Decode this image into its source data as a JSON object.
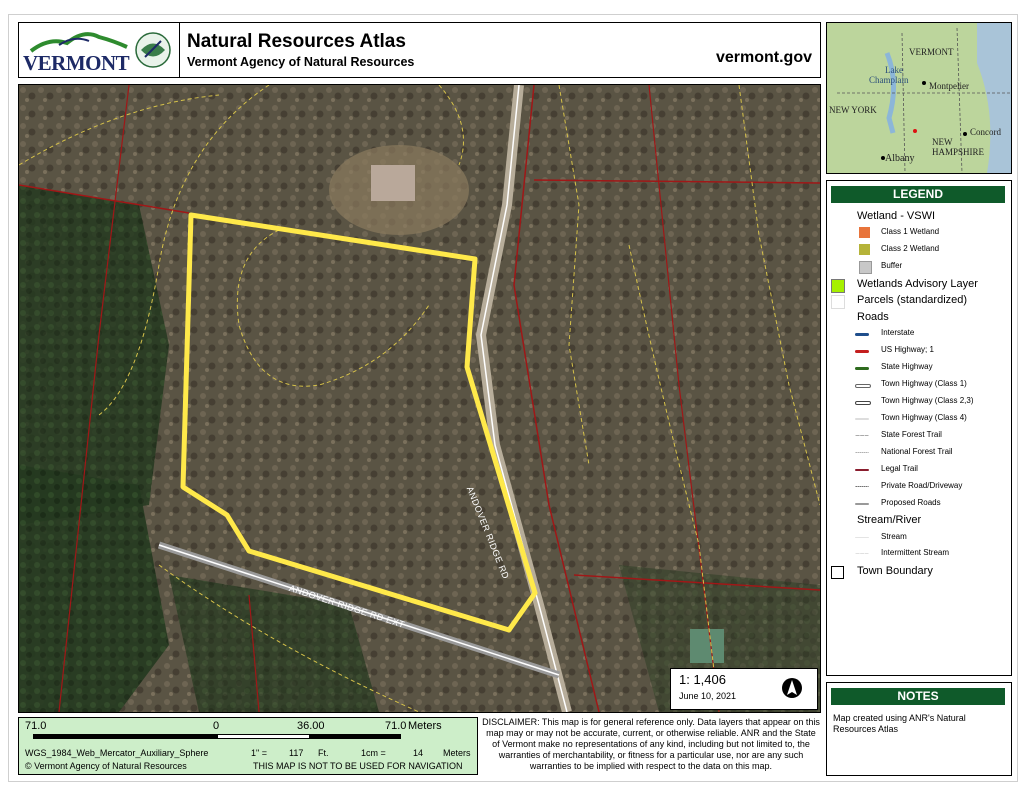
{
  "header": {
    "vermont_logo_text": "VERMONT",
    "title": "Natural Resources Atlas",
    "subtitle": "Vermont Agency of Natural Resources",
    "site": "vermont.gov"
  },
  "inset": {
    "labels": [
      "VERMONT",
      "Lake",
      "Champlain",
      "Montpelier",
      "NEW YORK",
      "Concord",
      "NEW",
      "HAMPSHIRE",
      "Albany"
    ]
  },
  "map": {
    "road_labels": [
      "ANDOVER RIDGE RD",
      "ANDOVER RIDGE RD EXT"
    ],
    "scale": "1: 1,406",
    "date": "June 10, 2021"
  },
  "legend": {
    "title": "LEGEND",
    "wetland_title": "Wetland - VSWI",
    "class1": "Class 1 Wetland",
    "class2": "Class 2 Wetland",
    "buffer": "Buffer",
    "advisory": "Wetlands Advisory Layer",
    "parcels": "Parcels (standardized)",
    "roads_title": "Roads",
    "interstate": "Interstate",
    "us_highway": "US Highway; 1",
    "state_highway": "State Highway",
    "town1": "Town Highway (Class 1)",
    "town23": "Town Highway (Class 2,3)",
    "town4": "Town Highway (Class 4)",
    "state_forest": "State Forest Trail",
    "national_forest": "National Forest Trail",
    "legal_trail": "Legal Trail",
    "private_road": "Private Road/Driveway",
    "proposed": "Proposed Roads",
    "stream_title": "Stream/River",
    "stream": "Stream",
    "intermittent": "Intermittent Stream",
    "town_boundary": "Town Boundary",
    "colors": {
      "class1": "#e8743b",
      "class2": "#b5b339",
      "buffer": "#c8c8c8",
      "advisory": "#a6f000",
      "interstate": "#1f4e8c",
      "us_highway": "#c41e1e",
      "state_highway": "#2e6b1e"
    }
  },
  "notes": {
    "title": "NOTES",
    "text": "Map created using ANR's Natural Resources Atlas"
  },
  "scalebar": {
    "left": "71.0",
    "zero": "0",
    "mid": "36.00",
    "right": "71.0",
    "unit": "Meters",
    "projection": "WGS_1984_Web_Mercator_Auxiliary_Sphere",
    "inch_label": "1\" =",
    "inch_value": "117",
    "inch_unit": "Ft.",
    "cm_label": "1cm =",
    "cm_value": "14",
    "cm_unit": "Meters",
    "copyright": "© Vermont Agency of Natural Resources",
    "nav_warning": "THIS MAP IS NOT TO BE USED FOR NAVIGATION"
  },
  "disclaimer": "DISCLAIMER: This map is for general reference only. Data layers that appear on this map may or may not be accurate, current, or otherwise reliable. ANR and the State of Vermont make no representations of any kind, including but not limited to, the warranties of merchantability, or fitness for a particular use, nor are any such warranties to be implied with respect to the data on this map."
}
